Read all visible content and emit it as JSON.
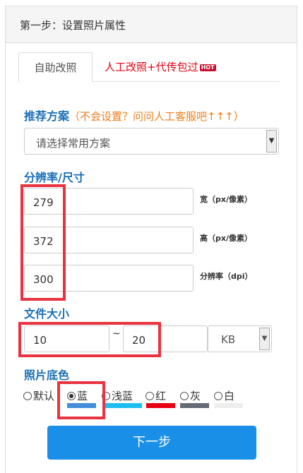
{
  "header": {
    "title": "第一步：设置照片属性"
  },
  "tabs": {
    "self": "自助改照",
    "manual": "人工改照+代传包过",
    "hot_badge": "HOT"
  },
  "scheme": {
    "title": "推荐方案",
    "hint": "（不会设置？问问人工客服吧↑↑↑）",
    "select_value": "请选择常用方案"
  },
  "resolution": {
    "title": "分辨率/尺寸",
    "width": {
      "value": "279",
      "unit": "宽（px/像素）"
    },
    "height": {
      "value": "372",
      "unit": "高（px/像素）"
    },
    "dpi": {
      "value": "300",
      "unit": "分辨率（dpi）"
    }
  },
  "filesize": {
    "title": "文件大小",
    "min": "10",
    "separator": "~",
    "max": "20",
    "unit": "KB"
  },
  "background": {
    "title": "照片底色",
    "options": [
      {
        "label": "默认",
        "selected": false,
        "color": ""
      },
      {
        "label": "蓝",
        "selected": true,
        "color": "#438edb"
      },
      {
        "label": "浅蓝",
        "selected": false,
        "color": "#1ebef0"
      },
      {
        "label": "红",
        "selected": false,
        "color": "#e60012"
      },
      {
        "label": "灰",
        "selected": false,
        "color": "#666a75"
      },
      {
        "label": "白",
        "selected": false,
        "color": "#eeeeee"
      }
    ]
  },
  "next_button": "下一步",
  "icons": {
    "select_arrow": "chevron-down-icon"
  },
  "colors": {
    "accent": "#1a8fe8",
    "title_blue": "#1a6fb7",
    "hint_orange": "#f07d1a",
    "highlight_red": "#ea3340"
  }
}
